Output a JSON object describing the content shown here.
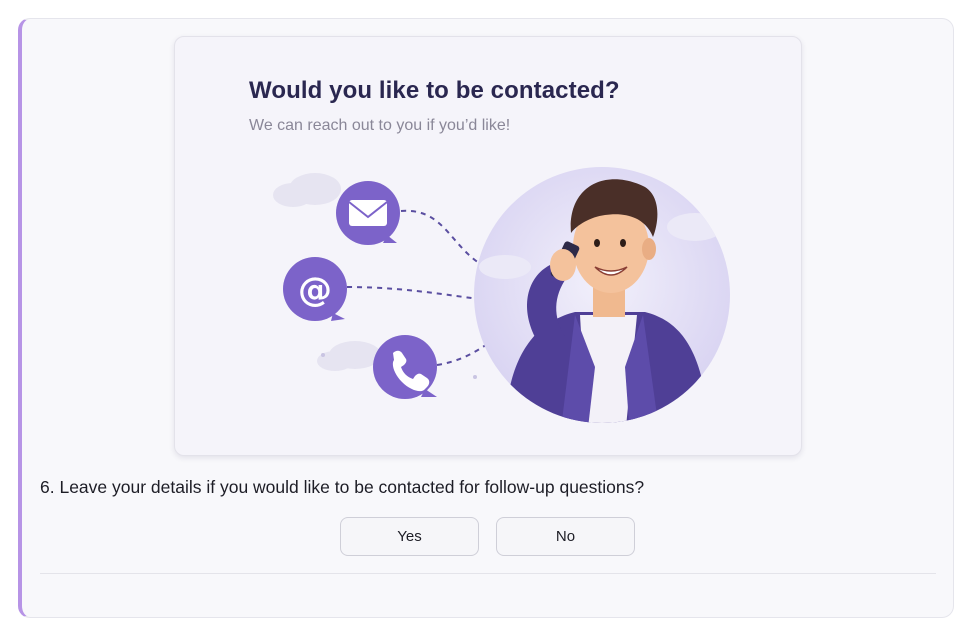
{
  "illustration": {
    "title": "Would you like to be contacted?",
    "subtitle": "We can reach out to you if you’d like!",
    "contact_icons": [
      "envelope-icon",
      "at-sign-icon",
      "phone-icon"
    ]
  },
  "question": {
    "text": "6. Leave your details if you would like to be contacted for follow-up questions?"
  },
  "options": {
    "yes_label": "Yes",
    "no_label": "No"
  },
  "colors": {
    "accent": "#b794e6",
    "icon_purple": "#7c63c9",
    "jacket": "#4f3f96",
    "title_text": "#2a2750"
  }
}
